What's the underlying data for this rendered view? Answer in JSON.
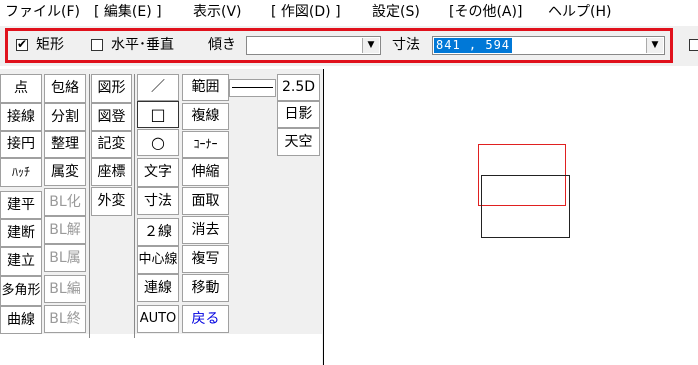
{
  "menu": [
    "ファイル(F)",
    "[ 編集(E) ]",
    "表示(V)",
    "[ 作図(D) ]",
    "設定(S)",
    "[その他(A)]",
    "ヘルプ(H)"
  ],
  "toolbar": {
    "rect_check_mark": "✔",
    "rect_label": "矩形",
    "hv_label": "水平･垂直",
    "tilt_label": "傾き",
    "tilt_value": "",
    "dim_label": "寸法",
    "dim_value": "841 , 594",
    "dropdown_arrow": "▼"
  },
  "tools": {
    "col1": [
      "点",
      "接線",
      "接円",
      "ﾊｯﾁ",
      "建平",
      "建断",
      "建立",
      "多角形",
      "曲線"
    ],
    "col2": [
      "包絡",
      "分割",
      "整理",
      "属変",
      "BL化",
      "BL解",
      "BL属",
      "BL編",
      "BL終"
    ],
    "col3": [
      "図形",
      "図登",
      "記変",
      "座標",
      "外変"
    ],
    "col4": [
      "／",
      "□",
      "○",
      "文字",
      "寸法",
      "２線",
      "中心線",
      "連線",
      "AUTO"
    ],
    "col5": [
      "範囲",
      "",
      "複線",
      "ｺｰﾅｰ",
      "伸縮",
      "面取",
      "消去",
      "複写",
      "移動",
      "戻る"
    ],
    "col6": [
      "2.5D",
      "日影",
      "天空"
    ]
  }
}
